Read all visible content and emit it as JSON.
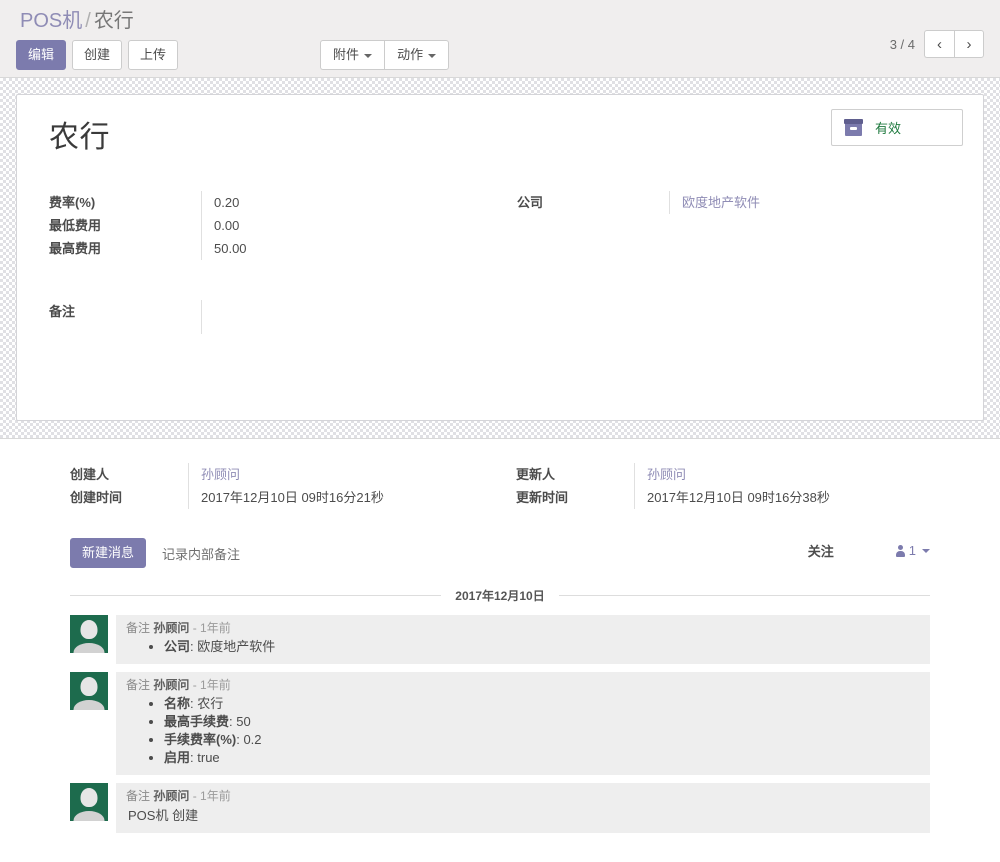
{
  "breadcrumb": {
    "parent": "POS机",
    "separator": "/",
    "current": "农行"
  },
  "toolbar": {
    "edit_label": "编辑",
    "create_label": "创建",
    "upload_label": "上传",
    "attachment_label": "附件",
    "action_label": "动作"
  },
  "pager": {
    "count": "3 / 4",
    "prev_icon": "‹",
    "next_icon": "›"
  },
  "record": {
    "title": "农行",
    "status_label": "有效",
    "status_color": "#1f7a3f",
    "accent_color": "#7c7bad",
    "fields_left": [
      {
        "label": "费率(%)",
        "value": "0.20"
      },
      {
        "label": "最低费用",
        "value": "0.00"
      },
      {
        "label": "最高费用",
        "value": "50.00"
      }
    ],
    "fields_right": [
      {
        "label": "公司",
        "value": "欧度地产软件",
        "link": true
      }
    ],
    "notes": {
      "label": "备注",
      "value": ""
    }
  },
  "meta": {
    "left": [
      {
        "label": "创建人",
        "value": "孙顾问",
        "muted": true
      },
      {
        "label": "创建时间",
        "value": "2017年12月10日 09时16分21秒",
        "muted": false
      }
    ],
    "right": [
      {
        "label": "更新人",
        "value": "孙顾问",
        "muted": true
      },
      {
        "label": "更新时间",
        "value": "2017年12月10日 09时16分38秒",
        "muted": false
      }
    ]
  },
  "chatter": {
    "new_message_label": "新建消息",
    "log_note_label": "记录内部备注",
    "follow_label": "关注",
    "follower_count": "1",
    "date_divider": "2017年12月10日",
    "messages": [
      {
        "prefix": "备注",
        "author": "孙顾问",
        "age": "- 1年前",
        "items": [
          {
            "label": "公司",
            "value": "欧度地产软件"
          }
        ],
        "text": ""
      },
      {
        "prefix": "备注",
        "author": "孙顾问",
        "age": "- 1年前",
        "items": [
          {
            "label": "名称",
            "value": "农行"
          },
          {
            "label": "最高手续费",
            "value": "50"
          },
          {
            "label": "手续费率(%)",
            "value": "0.2"
          },
          {
            "label": "启用",
            "value": "true"
          }
        ],
        "text": ""
      },
      {
        "prefix": "备注",
        "author": "孙顾问",
        "age": "- 1年前",
        "items": [],
        "text": "POS机 创建"
      }
    ]
  }
}
